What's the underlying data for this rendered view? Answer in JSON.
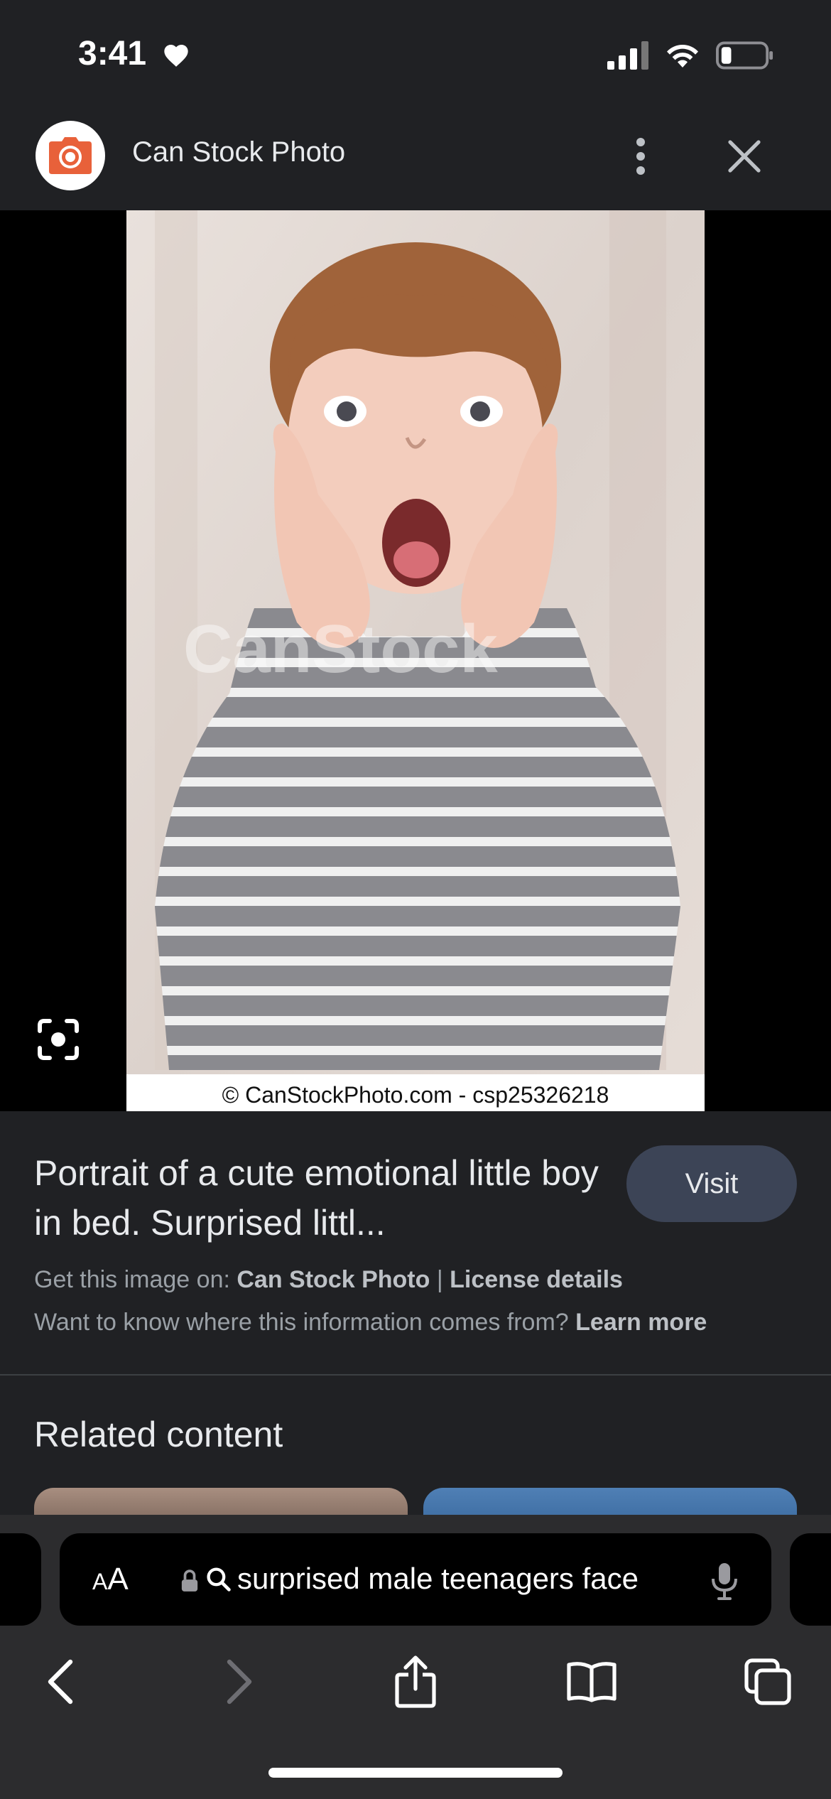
{
  "status_bar": {
    "time": "3:41"
  },
  "header": {
    "site_name": "Can Stock Photo"
  },
  "image": {
    "watermark": "CanStock",
    "credit": "© CanStockPhoto.com - csp25326218"
  },
  "result": {
    "title": "Portrait of a cute emotional little boy in bed. Surprised littl...",
    "visit_label": "Visit",
    "get_image_prefix": "Get this image on:",
    "source_link": "Can Stock Photo",
    "separator": "|",
    "license_link": "License details",
    "info_question": "Want to know where this information comes from?",
    "learn_more": "Learn more"
  },
  "related": {
    "heading": "Related content"
  },
  "safari": {
    "text_size_label_small": "A",
    "text_size_label_large": "A",
    "address": "surprised male teenagers face"
  },
  "colors": {
    "brand_orange": "#e8613a",
    "visit_button": "#3c4456",
    "background": "#202124"
  }
}
